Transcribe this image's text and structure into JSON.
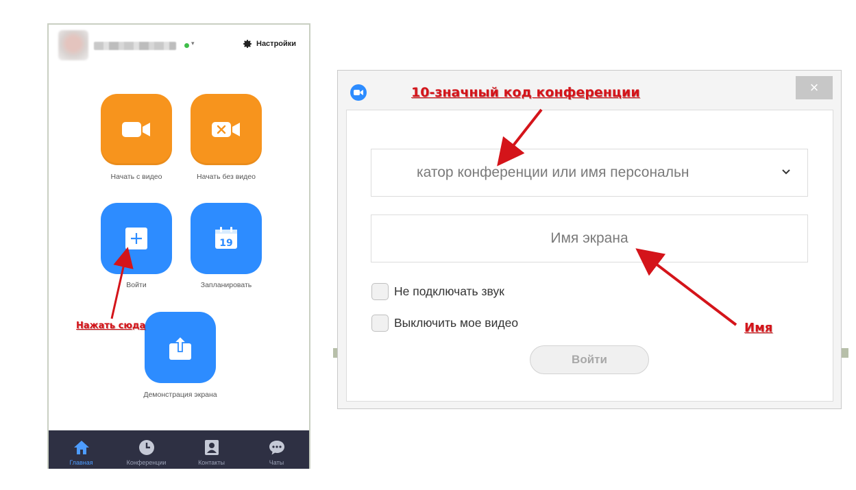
{
  "home": {
    "settings_label": "Настройки",
    "tiles": {
      "start_video": "Начать с видео",
      "start_no_video": "Начать без видео",
      "join": "Войти",
      "schedule": "Запланировать",
      "schedule_date": "19",
      "share_screen": "Демонстрация экрана"
    },
    "footer": [
      {
        "label": "Главная",
        "icon": "home-icon"
      },
      {
        "label": "Конференции",
        "icon": "clock-icon"
      },
      {
        "label": "Контакты",
        "icon": "contacts-icon"
      },
      {
        "label": "Чаты",
        "icon": "chat-icon"
      }
    ]
  },
  "annotations": {
    "click_here": "Нажать сюда",
    "meeting_code": "10-значный код конференции",
    "name": "Имя"
  },
  "join_dialog": {
    "close_label": "×",
    "meeting_id_placeholder": "катор конференции или имя персональн",
    "name_placeholder": "Имя экрана",
    "no_audio_label": "Не подключать звук",
    "video_off_label": "Выключить мое видео",
    "join_label": "Войти"
  },
  "colors": {
    "orange_tile": "#f7941d",
    "blue_tile": "#2d8cff",
    "footer_bg": "#2e3043",
    "annotation_red": "#d4141a"
  }
}
